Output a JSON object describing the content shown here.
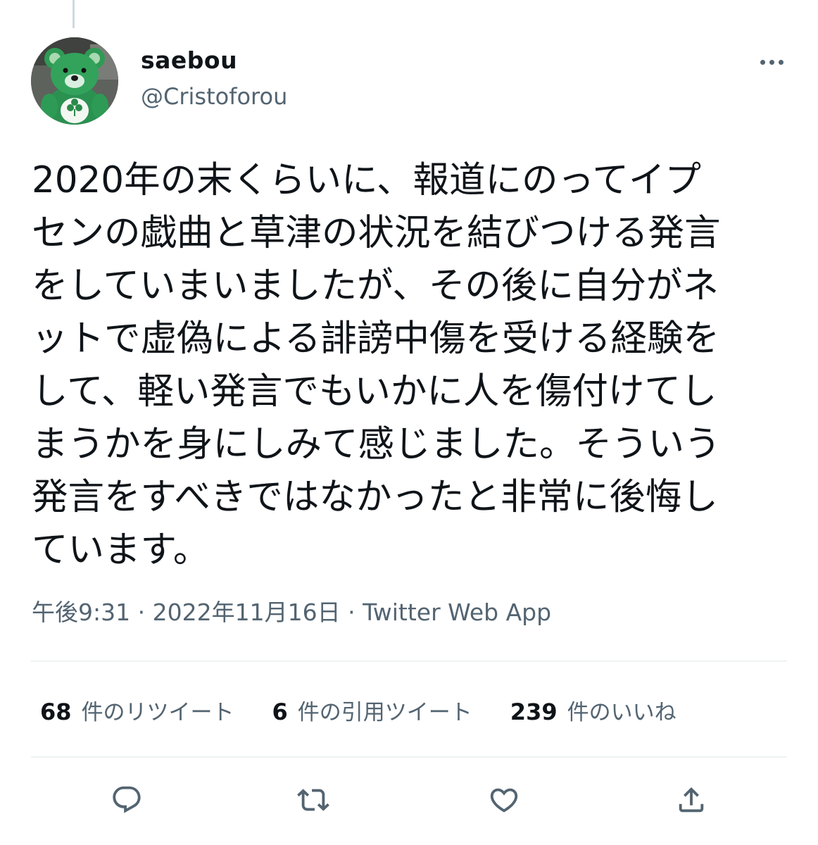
{
  "user": {
    "display_name": "saebou",
    "handle": "@Cristoforou",
    "avatar": "green-teddy-bear-with-shamrock"
  },
  "tweet": {
    "lines": [
      "2020年の末くらいに、報道にのってイプ",
      "センの戯曲と草津の状況を結びつける発言",
      "をしていまいましたが、その後に自分がネ",
      "ットで虚偽による誹謗中傷を受ける経験を",
      "して、軽い発言でもいかに人を傷付けてし",
      "まうかを身にしみて感じました。そういう",
      "発言をすべきではなかったと非常に後悔し",
      "ています。"
    ]
  },
  "meta": {
    "time": "午後9:31",
    "separator": "·",
    "date": "2022年11月16日",
    "source": "Twitter Web App"
  },
  "stats": {
    "retweets": {
      "count": "68",
      "label": "件のリツイート"
    },
    "quotes": {
      "count": "6",
      "label": "件の引用ツイート"
    },
    "likes": {
      "count": "239",
      "label": "件のいいね"
    }
  },
  "actions": {
    "reply_icon": "reply-icon",
    "retweet_icon": "retweet-icon",
    "like_icon": "heart-icon",
    "share_icon": "share-icon"
  },
  "colors": {
    "text_primary": "#0f1419",
    "text_secondary": "#536471",
    "divider": "#eff3f4"
  }
}
